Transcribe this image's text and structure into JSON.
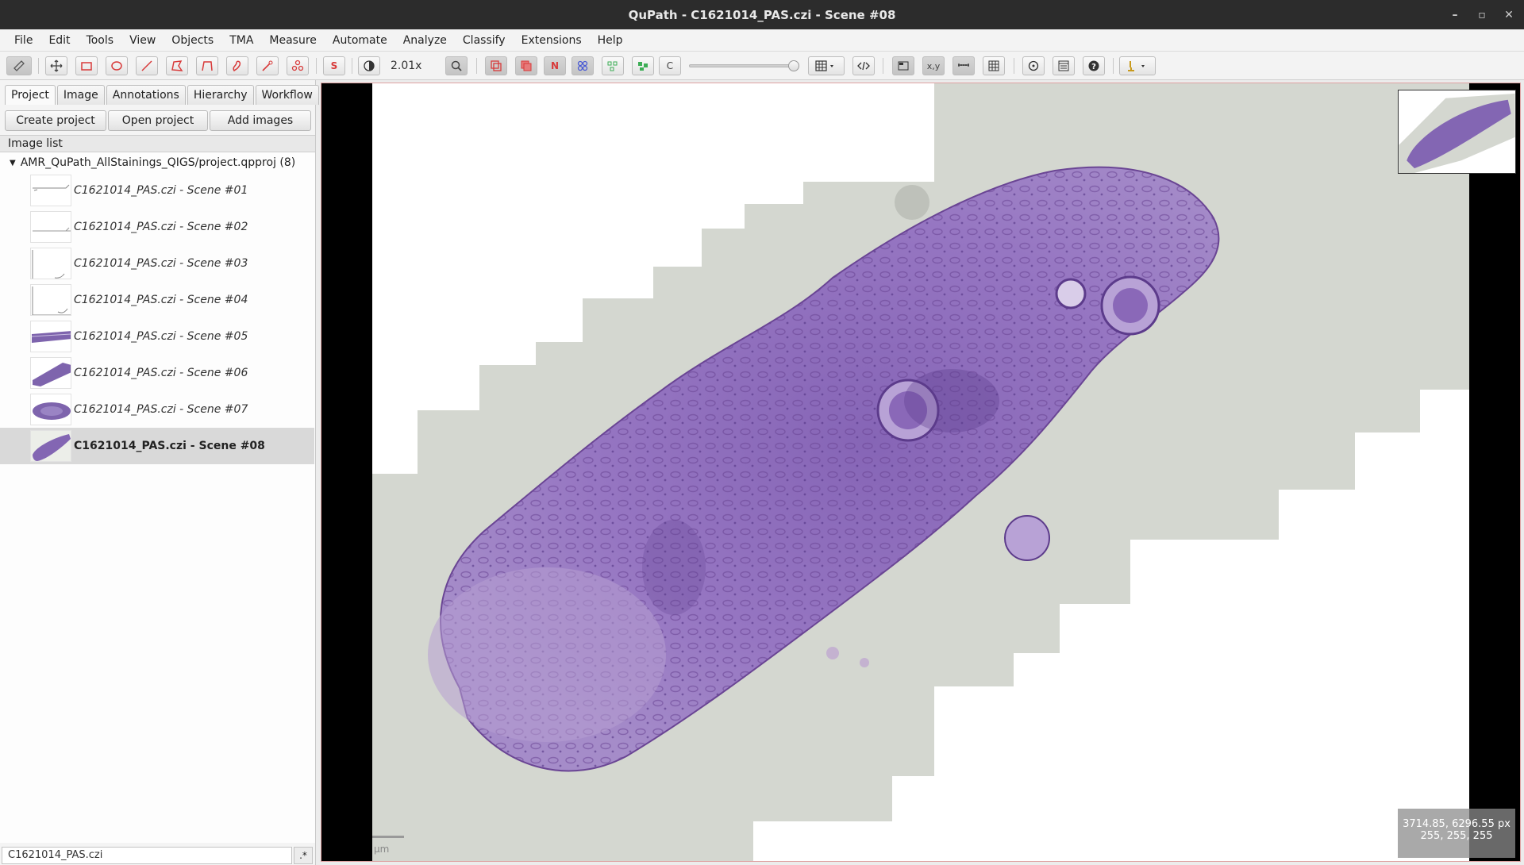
{
  "window": {
    "title": "QuPath - C1621014_PAS.czi - Scene #08"
  },
  "menu": [
    "File",
    "Edit",
    "Tools",
    "View",
    "Objects",
    "TMA",
    "Measure",
    "Automate",
    "Analyze",
    "Classify",
    "Extensions",
    "Help"
  ],
  "toolbar": {
    "zoom": "2.01x",
    "s_label": "S",
    "n_label": "N",
    "c_label": "C"
  },
  "tabs": [
    "Project",
    "Image",
    "Annotations",
    "Hierarchy",
    "Workflow"
  ],
  "project_buttons": [
    "Create project",
    "Open project",
    "Add images"
  ],
  "image_list": {
    "header": "Image list",
    "root": "AMR_QuPath_AllStainings_QIGS/project.qpproj (8)",
    "items": [
      "C1621014_PAS.czi - Scene #01",
      "C1621014_PAS.czi - Scene #02",
      "C1621014_PAS.czi - Scene #03",
      "C1621014_PAS.czi - Scene #04",
      "C1621014_PAS.czi - Scene #05",
      "C1621014_PAS.czi - Scene #06",
      "C1621014_PAS.czi - Scene #07",
      "C1621014_PAS.czi - Scene #08"
    ],
    "selected": "C1621014_PAS.czi - Scene #08",
    "filter_value": "C1621014_PAS.czi",
    "regex_label": ".*"
  },
  "viewer": {
    "coords_line1": "3714.85, 6296.55 px",
    "coords_line2": "255, 255, 255",
    "scale_unit": "µm"
  },
  "colors": {
    "tissue": "#8e6bb8",
    "tissue_dark": "#6b4592",
    "background_tile": "#d3d6cf",
    "accent_red": "#d83a3a"
  }
}
